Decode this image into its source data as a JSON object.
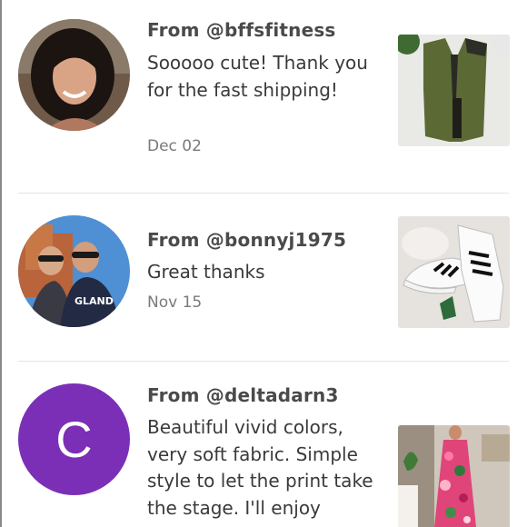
{
  "reviews": [
    {
      "author": "From @bffsfitness",
      "comment": "Sooooo cute! Thank you for the fast shipping!",
      "date": "Dec 02"
    },
    {
      "author": "From @bonnyj1975",
      "comment": "Great thanks",
      "date": "Nov 15"
    },
    {
      "author": "From @deltadarn3",
      "avatar_initial": "C",
      "avatar_color": "#7b2fb7",
      "comment": "Beautiful vivid colors, very soft fabric. Simple style to let the print take the stage. I'll enjoy",
      "date": ""
    }
  ],
  "colors": {
    "divider": "#e4e4e4",
    "author_text": "#4a4a4a",
    "date_text": "#7a7a7a"
  }
}
